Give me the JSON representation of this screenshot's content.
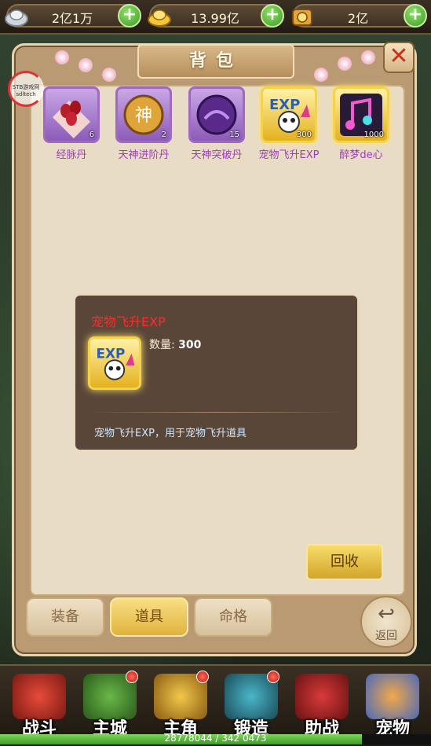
{
  "resources": [
    {
      "name": "silver-icon",
      "value": "2亿1万"
    },
    {
      "name": "gold-ingot-icon",
      "value": "13.99亿"
    },
    {
      "name": "coins-icon",
      "value": "2亿"
    }
  ],
  "panel": {
    "title": "背包",
    "logo_text": "STB游戏网 sdltech"
  },
  "items": [
    {
      "name": "经脉丹",
      "count": "6",
      "style": "purple",
      "icon": "meridian-pill-icon"
    },
    {
      "name": "天神进阶丹",
      "count": "2",
      "style": "purple",
      "icon": "god-advance-pill-icon"
    },
    {
      "name": "天神突破丹",
      "count": "15",
      "style": "purple",
      "icon": "god-breakthrough-pill-icon"
    },
    {
      "name": "宠物飞升EXP",
      "count": "300",
      "style": "gold",
      "icon": "pet-exp-icon"
    },
    {
      "name": "醉梦de心",
      "count": "1000",
      "style": "gold",
      "icon": "music-note-icon"
    }
  ],
  "tooltip": {
    "name": "宠物飞升EXP",
    "quantity_label": "数量:",
    "quantity": "300",
    "description": "宠物飞升EXP，用于宠物飞升道具"
  },
  "buttons": {
    "recycle": "回收",
    "back": "返回"
  },
  "tabs": [
    {
      "label": "装备",
      "active": false
    },
    {
      "label": "道具",
      "active": true
    },
    {
      "label": "命格",
      "active": false
    }
  ],
  "nav": [
    {
      "label": "战斗",
      "icon": "battle-icon",
      "badge": false
    },
    {
      "label": "主城",
      "icon": "city-icon",
      "badge": true
    },
    {
      "label": "主角",
      "icon": "hero-icon",
      "badge": true
    },
    {
      "label": "锻造",
      "icon": "forge-icon",
      "badge": true
    },
    {
      "label": "助战",
      "icon": "assist-icon",
      "badge": false
    },
    {
      "label": "宠物",
      "icon": "pet-icon",
      "badge": false
    }
  ],
  "exp_bar": {
    "text": "28778044 / 342 0473",
    "progress": 0.84
  },
  "colors": {
    "tooltip_name": "#ff2b2b",
    "item_name": "#9b3fb5",
    "description": "#cde7ff"
  }
}
